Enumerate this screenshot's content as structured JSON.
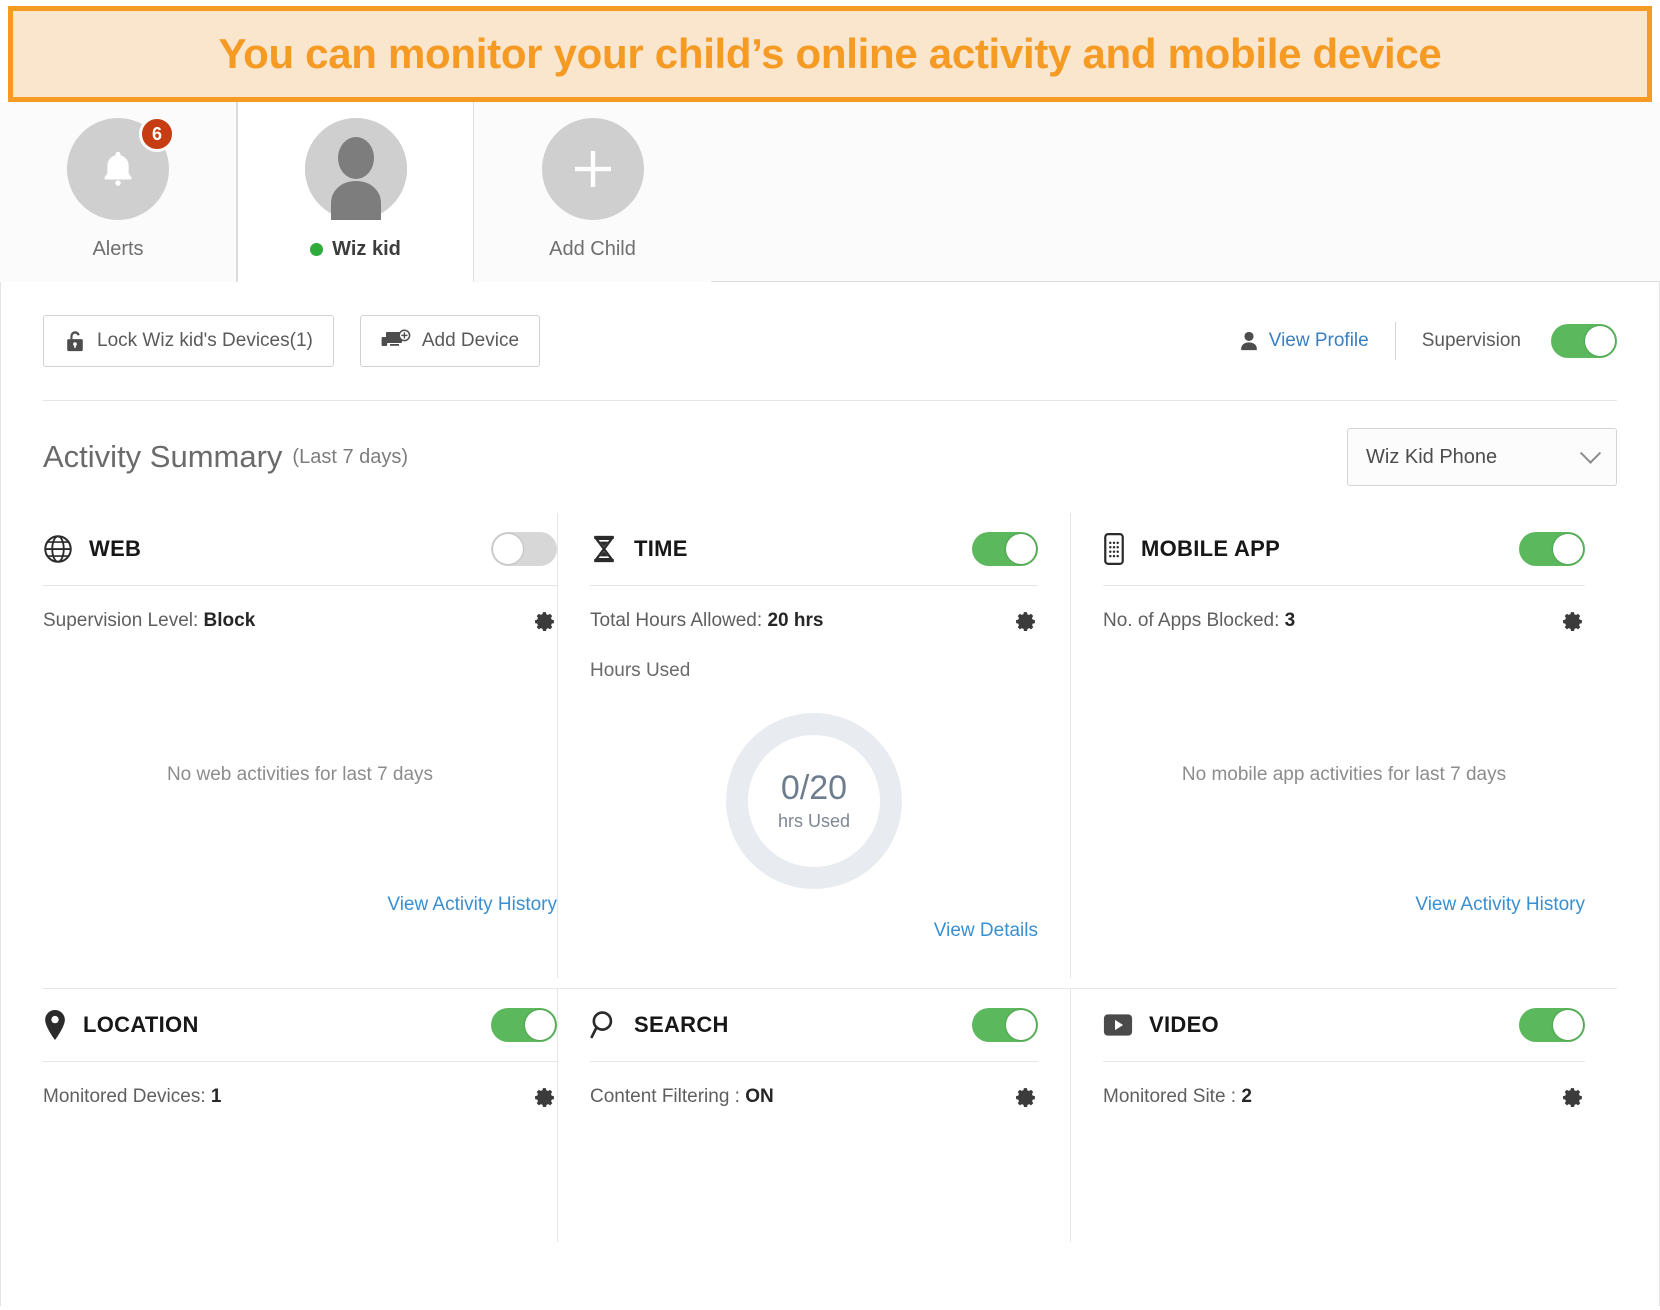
{
  "banner": {
    "text": "You can monitor your child’s online activity and mobile device"
  },
  "tabs": [
    {
      "label": "Alerts",
      "icon": "bell-icon",
      "badge": "6",
      "active": false
    },
    {
      "label": "Wiz kid",
      "icon": "avatar-icon",
      "active": true,
      "online": true
    },
    {
      "label": "Add Child",
      "icon": "plus-icon",
      "active": false
    }
  ],
  "toolbar": {
    "lock_button": "Lock Wiz kid's Devices(1)",
    "add_device_button": "Add Device",
    "view_profile": "View Profile",
    "supervision_label": "Supervision",
    "supervision_on": true
  },
  "summary": {
    "title": "Activity Summary",
    "subtitle": "(Last 7 days)",
    "device_selected": "Wiz Kid Phone"
  },
  "cards": {
    "web": {
      "title": "WEB",
      "icon": "globe-icon",
      "toggle_on": false,
      "meta_label": "Supervision Level:",
      "meta_value": "Block",
      "empty": "No web activities for last 7 days",
      "link": "View Activity History"
    },
    "time": {
      "title": "TIME",
      "icon": "hourglass-icon",
      "toggle_on": true,
      "meta_label": "Total Hours Allowed:",
      "meta_value": "20 hrs",
      "hours_used_label": "Hours Used",
      "donut_value": "0/20",
      "donut_caption": "hrs Used",
      "link": "View Details"
    },
    "mobile_app": {
      "title": "MOBILE APP",
      "icon": "phone-icon",
      "toggle_on": true,
      "meta_label": "No. of Apps Blocked:",
      "meta_value": "3",
      "empty": "No mobile app activities for last 7 days",
      "link": "View Activity History"
    },
    "location": {
      "title": "LOCATION",
      "icon": "pin-icon",
      "toggle_on": true,
      "meta_label": "Monitored Devices:",
      "meta_value": "1"
    },
    "search": {
      "title": "SEARCH",
      "icon": "magnifier-icon",
      "toggle_on": true,
      "meta_label": "Content Filtering :",
      "meta_value": "ON"
    },
    "video": {
      "title": "VIDEO",
      "icon": "video-icon",
      "toggle_on": true,
      "meta_label": "Monitored Site :",
      "meta_value": "2"
    }
  },
  "colors": {
    "accent_orange": "#f59a23",
    "banner_bg": "#fae5cd",
    "toggle_on": "#5cb85c",
    "toggle_off": "#d7d7d7",
    "link_blue": "#3a8fd0",
    "badge_red": "#c63c13",
    "online_green": "#2eab3b"
  }
}
